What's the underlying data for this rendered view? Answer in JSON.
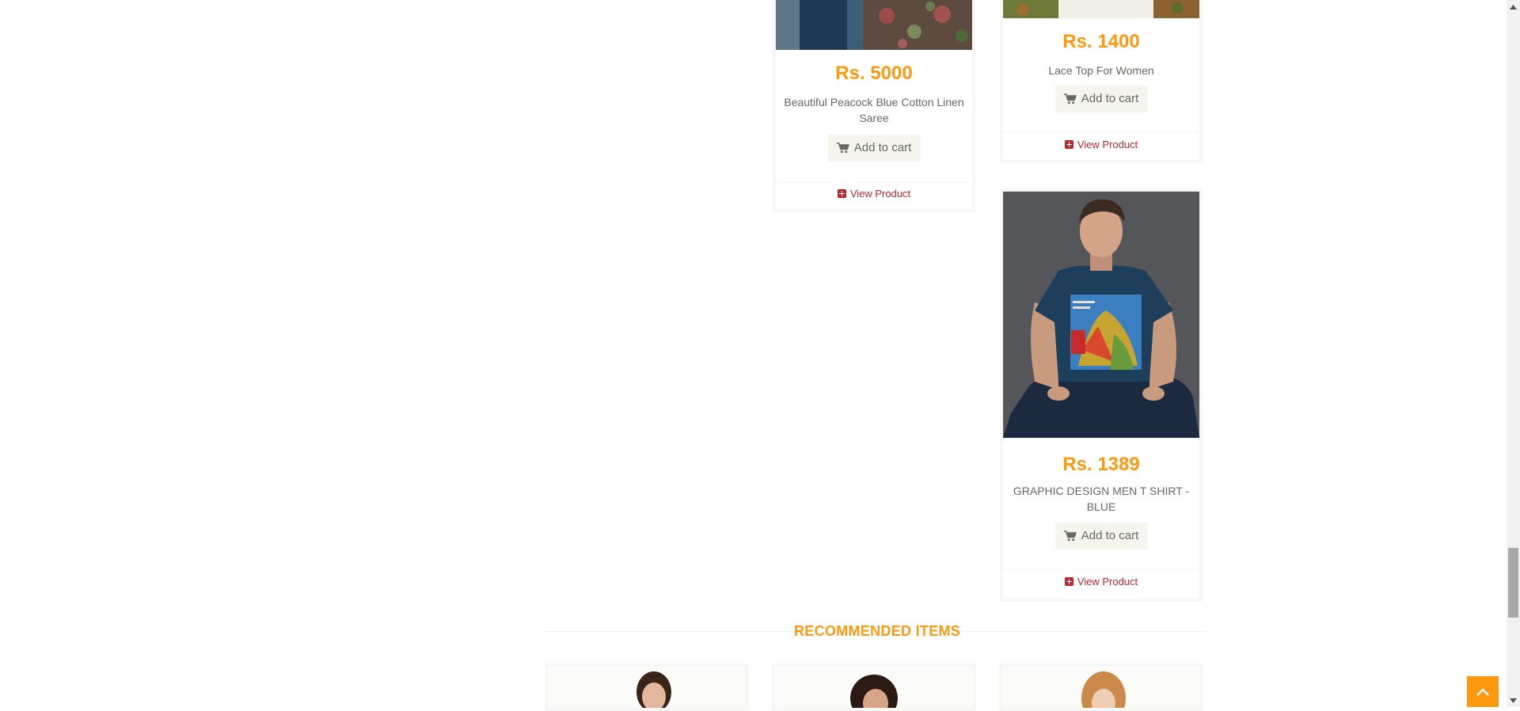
{
  "products": [
    {
      "price": "Rs. 5000",
      "name": "Beautiful Peacock Blue Cotton Linen Saree",
      "cart_label": "Add to cart",
      "view_label": "View Product"
    },
    {
      "price": "Rs. 1400",
      "name": "Lace Top For Women",
      "cart_label": "Add to cart",
      "view_label": "View Product"
    },
    {
      "price": "Rs. 1389",
      "name": "GRAPHIC DESIGN MEN T SHIRT - BLUE",
      "cart_label": "Add to cart",
      "view_label": "View Product",
      "image_icon": "man-in-graphic-tshirt-photo"
    }
  ],
  "recommended": {
    "title": "RECOMMENDED ITEMS"
  },
  "colors": {
    "accent": "#fe980f",
    "link": "#b8282a",
    "text": "#696763",
    "button_bg": "#f5f5ed"
  },
  "icons": {
    "cart": "shopping-cart-icon",
    "view": "plus-square-icon",
    "scroll_up": "chevron-up-icon"
  }
}
